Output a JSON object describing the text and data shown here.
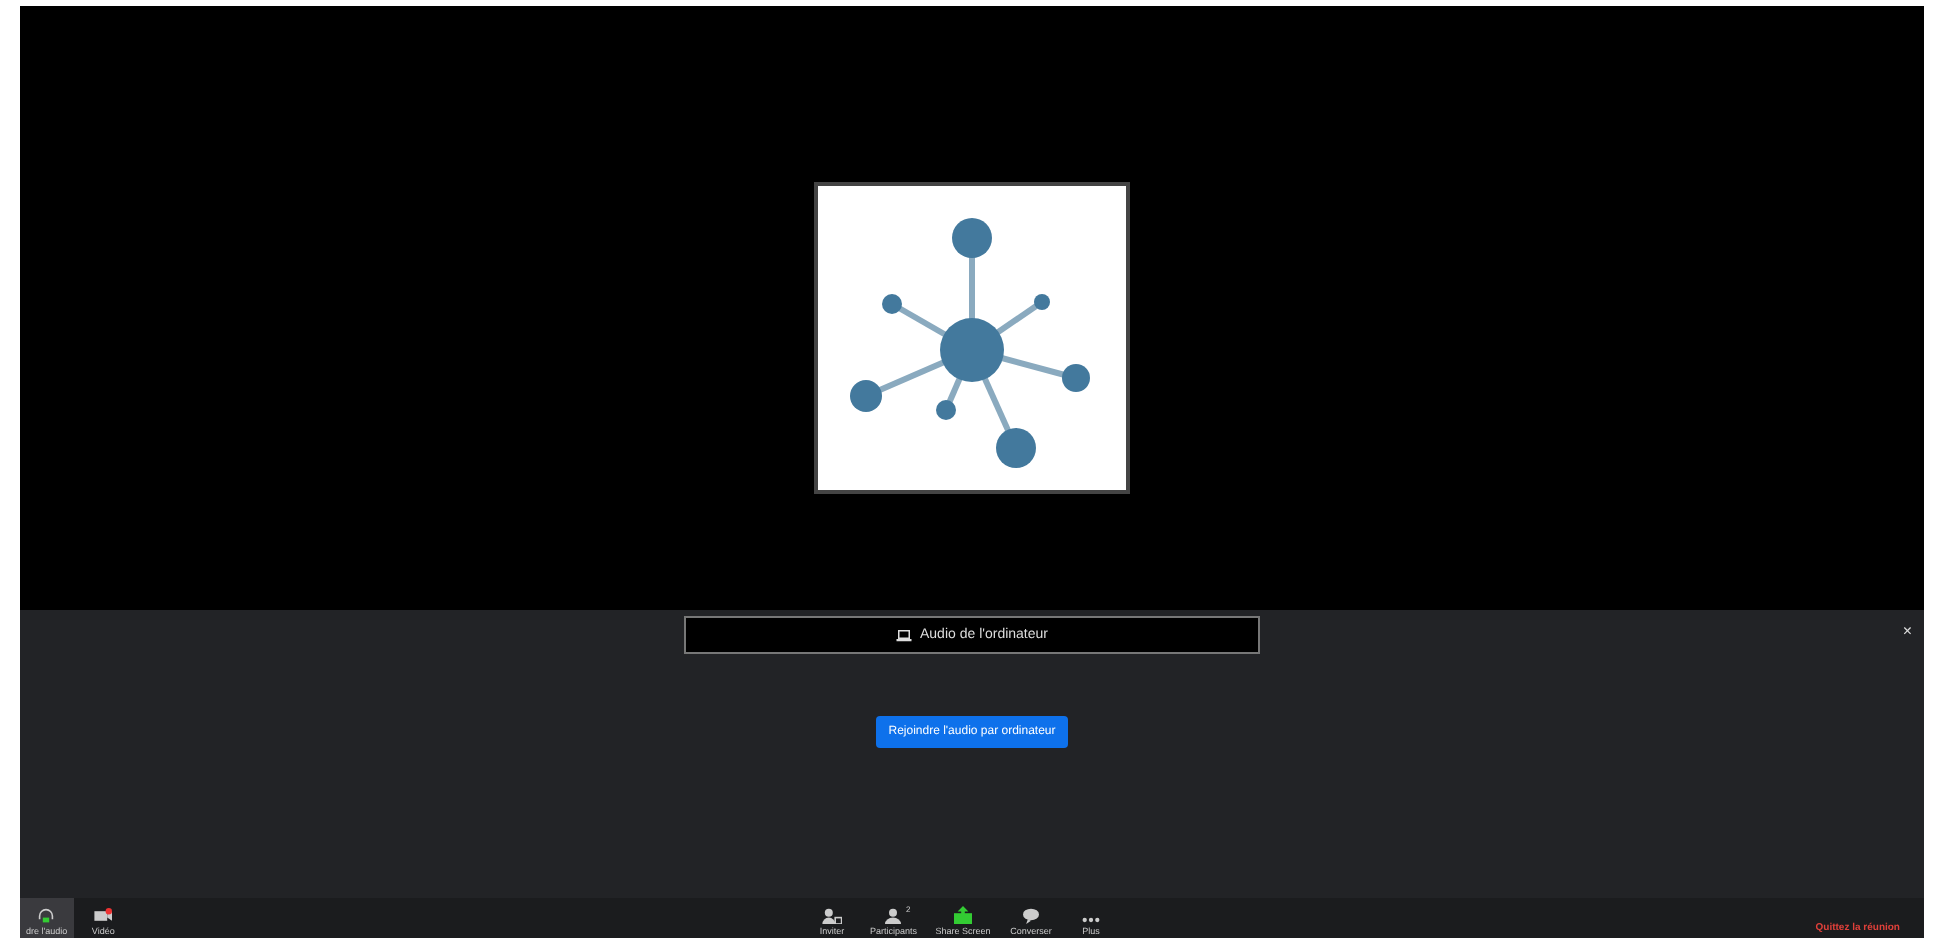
{
  "audio_panel": {
    "tab_label": "Audio de l'ordinateur",
    "close": "×",
    "join_button": "Rejoindre l'audio par ordinateur"
  },
  "toolbar": {
    "left": [
      {
        "kind": "audio",
        "label": "dre l'audio",
        "selected": true
      },
      {
        "kind": "video",
        "label": "Vidéo",
        "selected": false
      }
    ],
    "center": [
      {
        "kind": "invite",
        "label": "Inviter"
      },
      {
        "kind": "participants",
        "label": "Participants",
        "count": "2"
      },
      {
        "kind": "share",
        "label": "Share Screen"
      },
      {
        "kind": "chat",
        "label": "Converser"
      },
      {
        "kind": "more",
        "label": "Plus"
      }
    ],
    "leave": "Quittez la réunion"
  }
}
